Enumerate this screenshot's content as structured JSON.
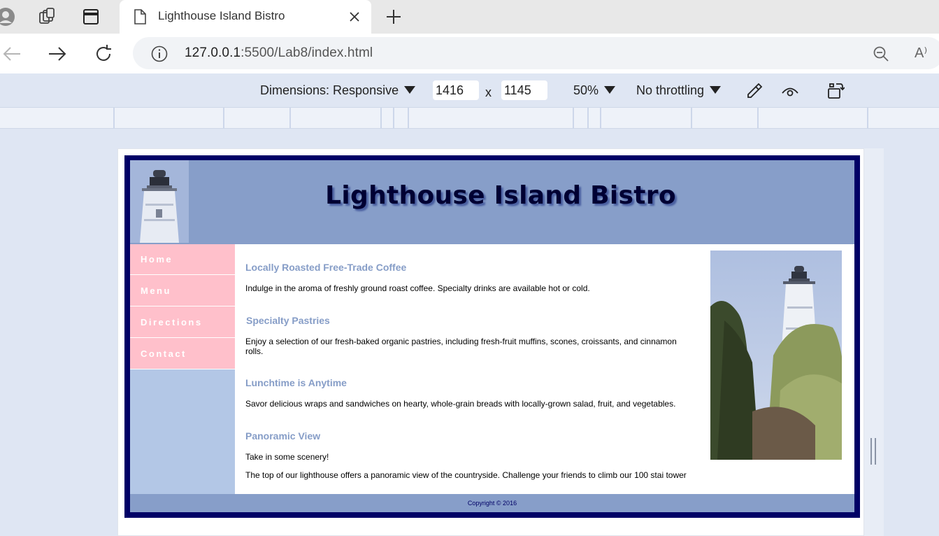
{
  "browser": {
    "tab_title": "Lighthouse Island Bistro",
    "url_host": "127.0.0.1",
    "url_path": ":5500/Lab8/index.html",
    "read_aloud_label": "A⁾"
  },
  "devtools": {
    "dimensions_label": "Dimensions: Responsive",
    "width_value": "1416",
    "times_sign": "x",
    "height_value": "1145",
    "zoom_label": "50%",
    "throttling_label": "No throttling"
  },
  "site": {
    "title": "Lighthouse Island Bistro",
    "nav": [
      "Home",
      "Menu",
      "Directions",
      "Contact"
    ],
    "sections": [
      {
        "heading": "Locally Roasted Free-Trade Coffee",
        "text": "Indulge in the aroma of freshly ground roast coffee. Specialty drinks are available hot or cold."
      },
      {
        "heading": "Specialty Pastries",
        "text": "Enjoy a selection of our fresh-baked organic pastries, including fresh-fruit muffins, scones, croissants, and cinnamon rolls."
      },
      {
        "heading": "Lunchtime is Anytime",
        "text": "Savor delicious wraps and sandwiches on hearty, whole-grain breads with locally-grown salad, fruit, and vegetables."
      },
      {
        "heading": "Panoramic View",
        "text": "Take in some scenery!",
        "text2": "The top of our lighthouse offers a panoramic view of the countryside. Challenge your friends to climb our 100 stai tower"
      }
    ],
    "footer": "Copyright © 2016"
  },
  "colors": {
    "site_border": "#000066",
    "header_bg": "#879ec9",
    "nav_item_bg": "#ffc0cb",
    "nav_bg": "#b3c7e6",
    "heading_color": "#869dc7"
  }
}
